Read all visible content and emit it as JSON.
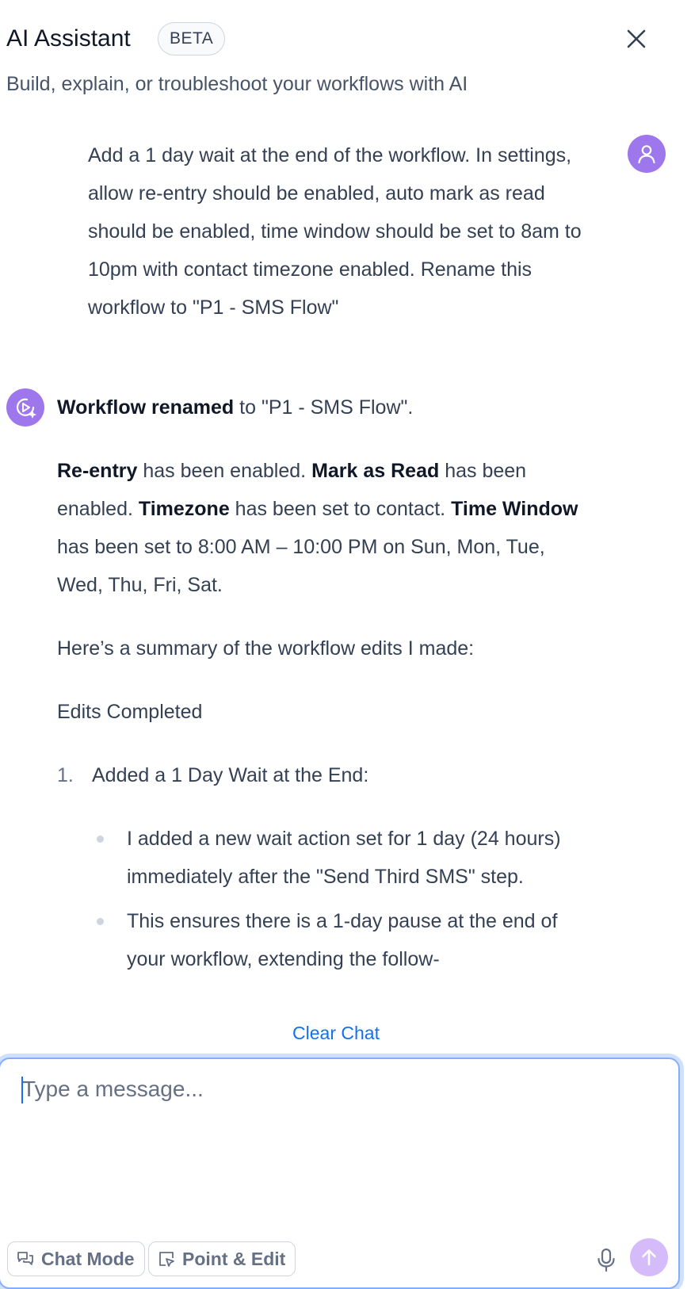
{
  "header": {
    "title": "AI Assistant",
    "badge": "BETA",
    "subtitle": "Build, explain, or troubleshoot your workflows with AI"
  },
  "icons": {
    "close": "close-icon",
    "user_avatar": "user-icon",
    "ai_avatar": "ai-sparkle-icon",
    "chat_mode": "chat-bubbles-icon",
    "point_edit": "pointer-edit-icon",
    "mic": "microphone-icon",
    "send": "arrow-up-icon"
  },
  "colors": {
    "accent": "#9e77ed",
    "link": "#1570ef",
    "send_disabled": "#d6bbfb",
    "focus_ring": "#84adff"
  },
  "user_message": "Add a 1 day wait at the end of the workflow. In settings, allow re-entry should be enabled, auto mark as read should be enabled, time window should be set to 8am to 10pm with contact timezone enabled. Rename this workflow to \"P1 - SMS Flow\"",
  "ai_message": {
    "rename_bold": "Workflow renamed",
    "rename_rest": " to \"P1 - SMS Flow\".",
    "reentry_bold": "Re-entry",
    "reentry_rest": " has been enabled. ",
    "markread_bold": "Mark as Read",
    "markread_rest": " has been enabled. ",
    "timezone_bold": "Timezone",
    "timezone_rest": " has been set to contact. ",
    "timewindow_bold": "Time Window",
    "timewindow_rest": " has been set to 8:00 AM – 10:00 PM on Sun, Mon, Tue, Wed, Thu, Fri, Sat.",
    "summary_intro": "Here’s a summary of the workflow edits I made:",
    "edits_heading": "Edits Completed",
    "edits": [
      {
        "number": "1.",
        "title": "Added a 1 Day Wait at the End:",
        "bullets": [
          "I added a new wait action set for 1 day (24 hours) immediately after the \"Send Third SMS\" step.",
          "This ensures there is a 1-day pause at the end of your workflow, extending the follow-"
        ]
      }
    ]
  },
  "clear_chat": "Clear Chat",
  "composer": {
    "placeholder": "Type a message...",
    "chat_mode_label": "Chat Mode",
    "point_edit_label": "Point & Edit"
  }
}
